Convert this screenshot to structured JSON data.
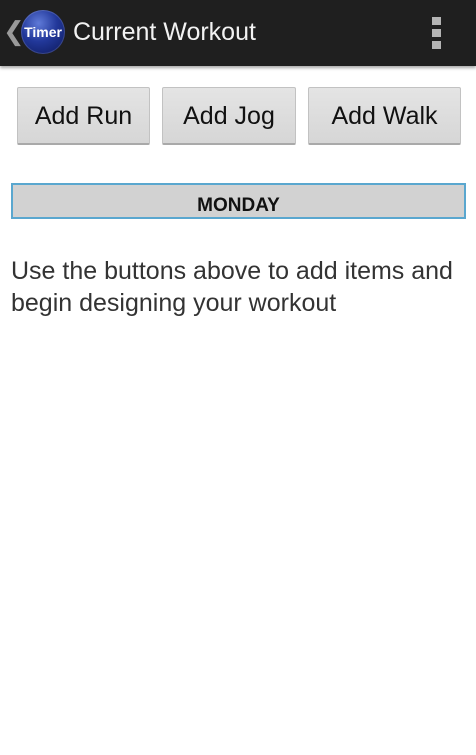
{
  "action_bar": {
    "back_glyph": "❮",
    "app_icon_label": "Timer",
    "title": "Current Workout",
    "overflow_icon": "more-vertical-icon",
    "background_color": "#1f1f1f"
  },
  "buttons": {
    "add_run": "Add Run",
    "add_jog": "Add Jog",
    "add_walk": "Add Walk"
  },
  "day_header": {
    "label": "MONDAY",
    "border_color": "#5aa7cf"
  },
  "hint_text": "Use the buttons above to add items and begin designing your workout"
}
